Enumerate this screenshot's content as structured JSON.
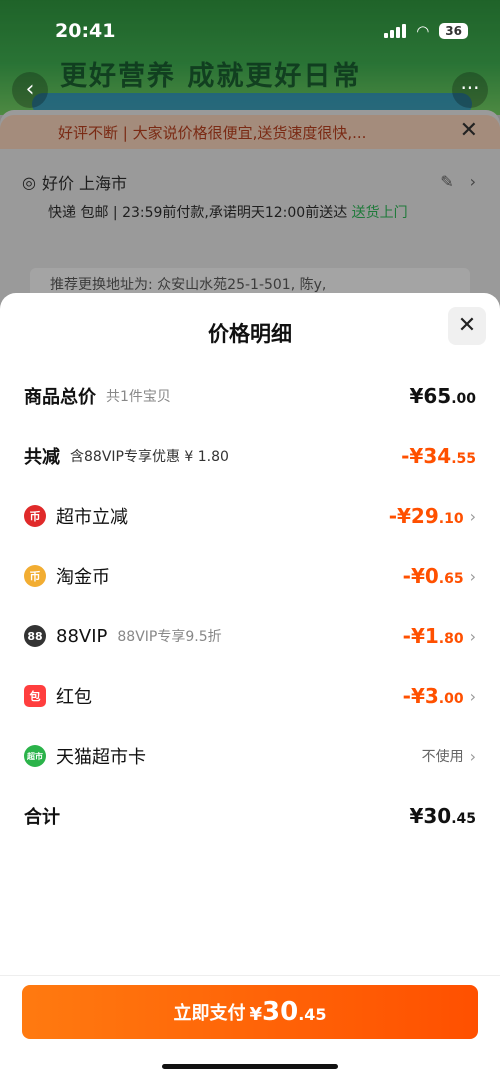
{
  "status": {
    "time": "20:41",
    "battery": "36"
  },
  "background": {
    "banner": "更好营养 成就更好日常",
    "notice": "好评不断 | 大家说价格很便宜,送货速度很快,...",
    "address_title": "好价 上海市",
    "address_detail_prefix": "快递 包邮 | 23:59前付款,承诺明天12:00前送达",
    "address_detail_green": "送货上门",
    "address_suggest": "推荐更换地址为: 众安山水苑25-1-501, 陈y,"
  },
  "sheet": {
    "title": "价格明细",
    "rows": [
      {
        "label": "商品总价",
        "sub": "共1件宝贝",
        "value_main": "¥65",
        "value_dec": ".00"
      },
      {
        "label": "共减",
        "sub": "含88VIP专享优惠 ¥ 1.80",
        "value_main": "-¥34",
        "value_dec": ".55"
      },
      {
        "label": "超市立减",
        "value_main": "-¥29",
        "value_dec": ".10"
      },
      {
        "label": "淘金币",
        "value_main": "-¥0",
        "value_dec": ".65"
      },
      {
        "label": "88VIP",
        "sub": "88VIP专享9.5折",
        "value_main": "-¥1",
        "value_dec": ".80"
      },
      {
        "label": "红包",
        "value_main": "-¥3",
        "value_dec": ".00"
      },
      {
        "label": "天猫超市卡",
        "right": "不使用"
      },
      {
        "label": "合计",
        "value_main": "¥30",
        "value_dec": ".45"
      }
    ],
    "icons": {
      "row2": "币",
      "row3": "币",
      "row4": "88",
      "row5": "包",
      "row6": "超市"
    }
  },
  "pay": {
    "label": "立即支付",
    "currency": "¥",
    "amount_main": "30",
    "amount_dec": ".45"
  },
  "colors": {
    "accent": "#ff5000",
    "brand_green": "#2c8a3a"
  }
}
